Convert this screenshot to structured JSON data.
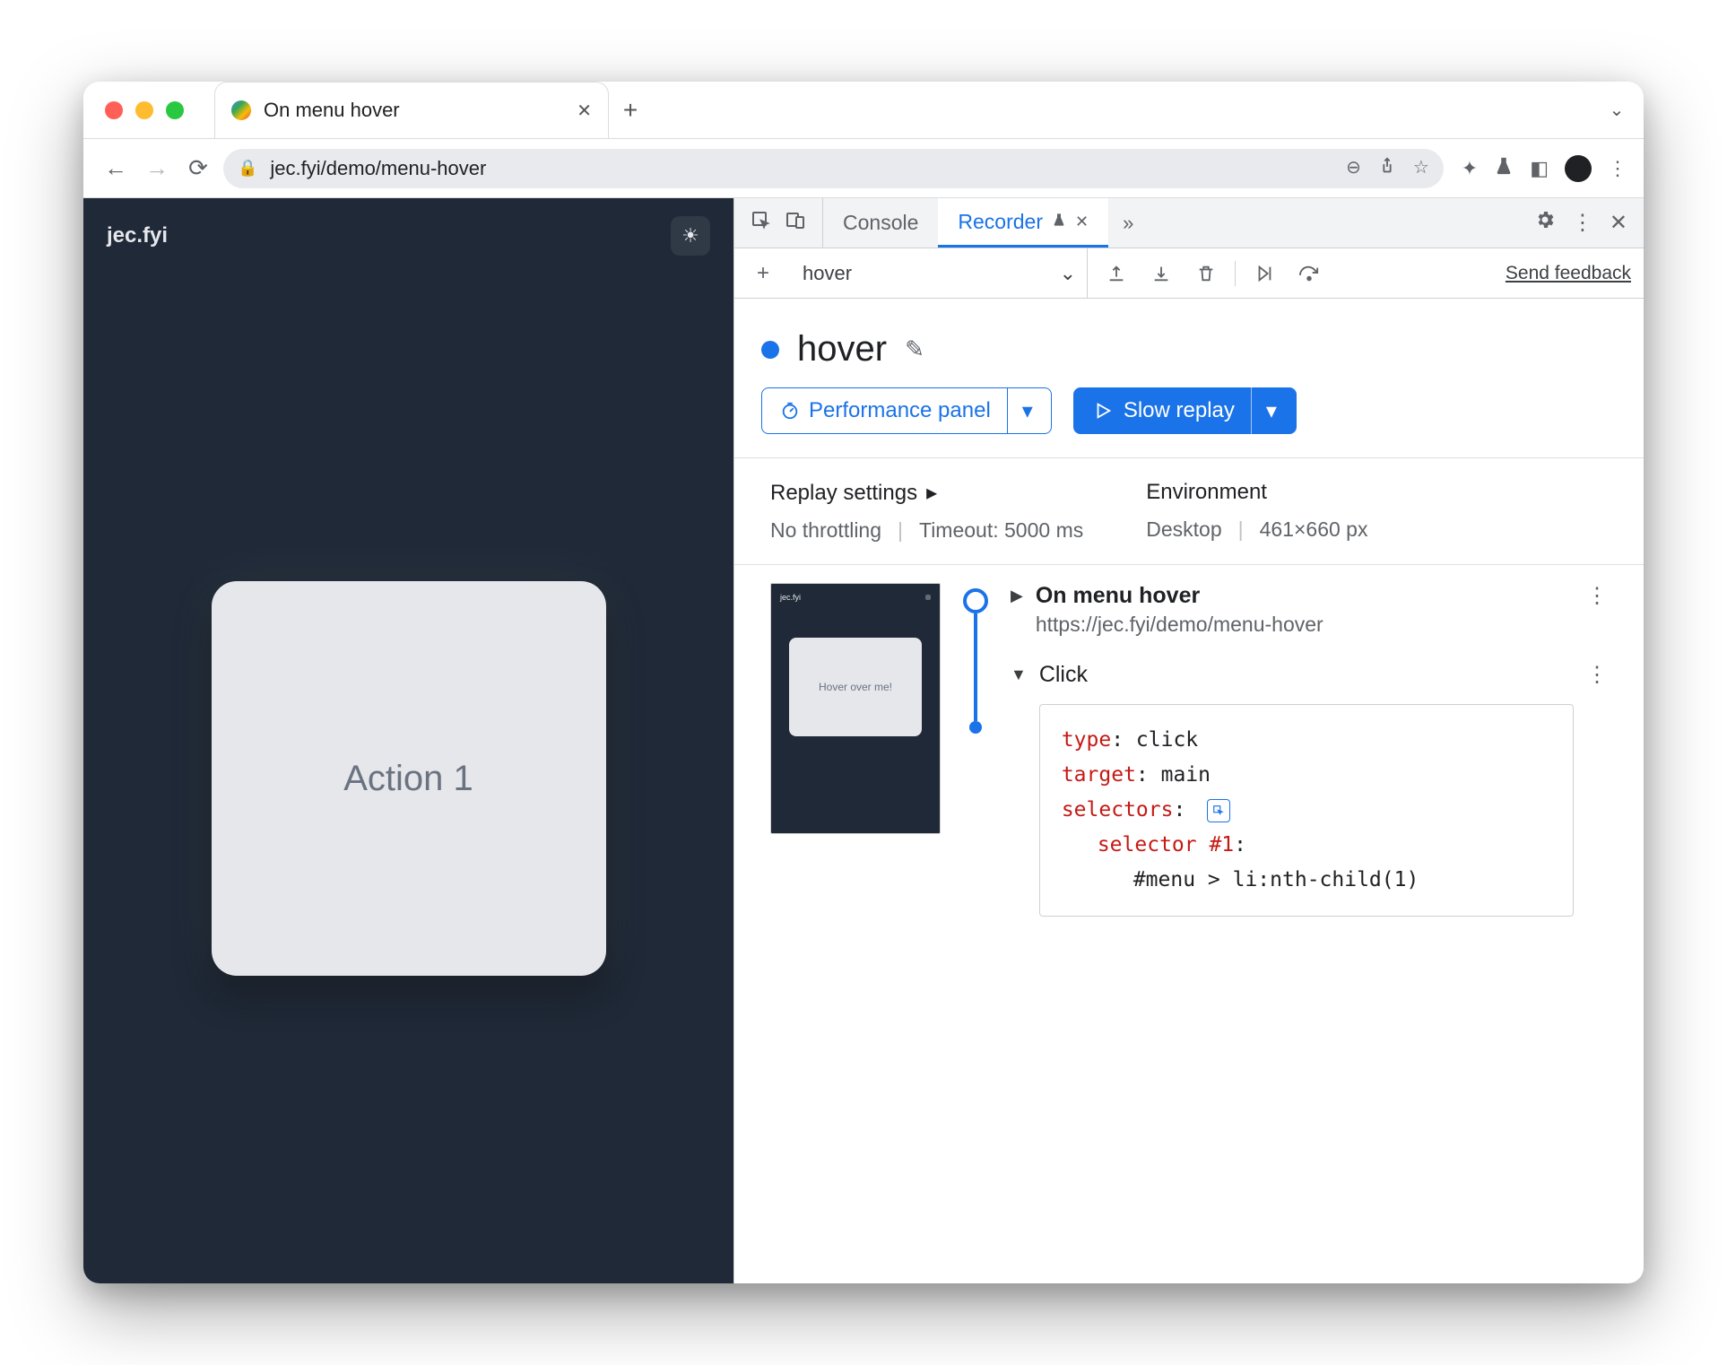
{
  "tab": {
    "title": "On menu hover"
  },
  "url": "jec.fyi/demo/menu-hover",
  "page": {
    "brand": "jec.fyi",
    "card_label": "Action 1"
  },
  "devtools": {
    "tabs": {
      "console": "Console",
      "recorder": "Recorder"
    }
  },
  "recorder": {
    "current_recording": "hover",
    "title": "hover",
    "perf_panel_label": "Performance panel",
    "slow_replay_label": "Slow replay",
    "send_feedback": "Send feedback",
    "settings": {
      "heading": "Replay settings",
      "throttling": "No throttling",
      "timeout": "Timeout: 5000 ms",
      "env_heading": "Environment",
      "env_device": "Desktop",
      "env_size": "461×660 px"
    },
    "thumb_brand": "jec.fyi",
    "thumb_card": "Hover over me!",
    "step1": {
      "title": "On menu hover",
      "url": "https://jec.fyi/demo/menu-hover"
    },
    "step2": {
      "title": "Click",
      "code": {
        "type_k": "type",
        "type_v": ": click",
        "target_k": "target",
        "target_v": ": main",
        "selectors_k": "selectors",
        "selectors_v": ":",
        "selector_k": "selector",
        "selector_num": " #1",
        "selector_v": ":",
        "css": "#menu > li:nth-child(1)"
      }
    }
  }
}
